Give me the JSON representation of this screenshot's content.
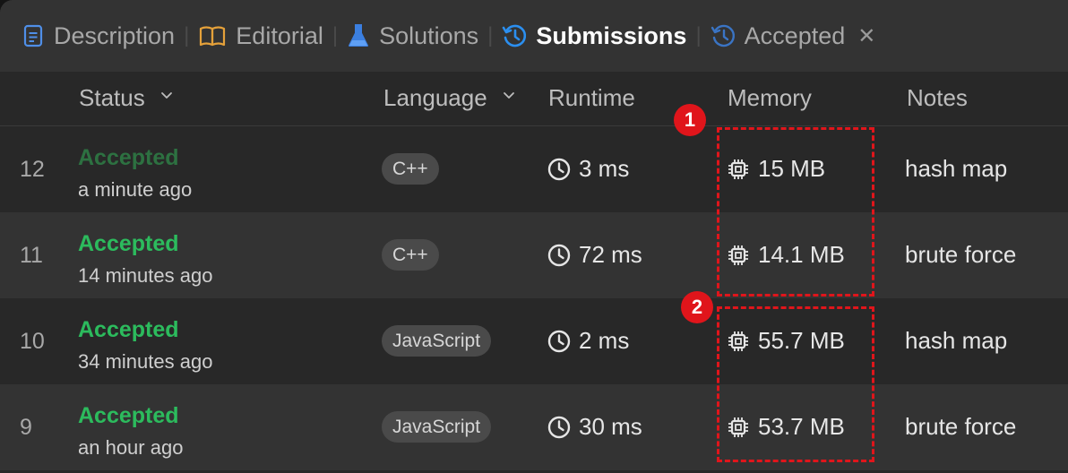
{
  "tabs": [
    {
      "label": "Description",
      "icon": "document-icon"
    },
    {
      "label": "Editorial",
      "icon": "book-icon"
    },
    {
      "label": "Solutions",
      "icon": "flask-icon"
    },
    {
      "label": "Submissions",
      "icon": "history-icon",
      "active": true
    },
    {
      "label": "Accepted",
      "icon": "history-icon"
    }
  ],
  "table": {
    "headers": {
      "status": "Status",
      "language": "Language",
      "runtime": "Runtime",
      "memory": "Memory",
      "notes": "Notes"
    },
    "rows": [
      {
        "num": "12",
        "status": "Accepted",
        "ago": "a minute ago",
        "language": "C++",
        "runtime": "3 ms",
        "memory": "15 MB",
        "notes": "hash map"
      },
      {
        "num": "11",
        "status": "Accepted",
        "ago": "14 minutes ago",
        "language": "C++",
        "runtime": "72 ms",
        "memory": "14.1 MB",
        "notes": "brute force"
      },
      {
        "num": "10",
        "status": "Accepted",
        "ago": "34 minutes ago",
        "language": "JavaScript",
        "runtime": "2 ms",
        "memory": "55.7 MB",
        "notes": "hash map"
      },
      {
        "num": "9",
        "status": "Accepted",
        "ago": "an hour ago",
        "language": "JavaScript",
        "runtime": "30 ms",
        "memory": "53.7 MB",
        "notes": "brute force"
      }
    ]
  },
  "annotations": [
    {
      "label": "1"
    },
    {
      "label": "2"
    }
  ],
  "colors": {
    "accepted": "#2cbb5d",
    "active_tab_icon": "#2b8ff0",
    "annotation": "#e0151b"
  }
}
